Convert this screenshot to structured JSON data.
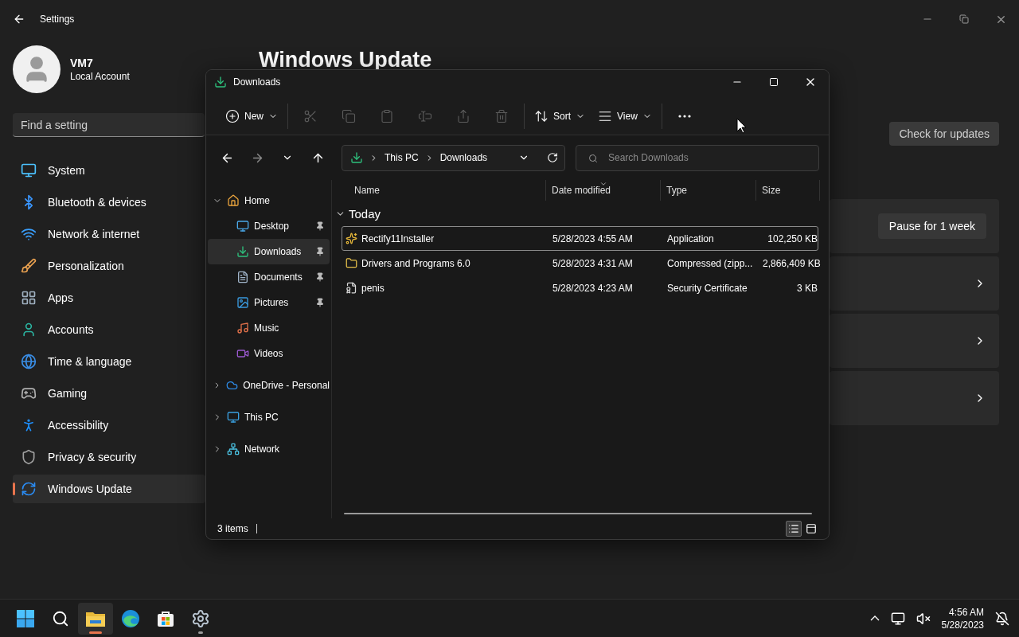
{
  "settings": {
    "title": "Settings",
    "account": {
      "name": "VM7",
      "type": "Local Account"
    },
    "search": {
      "placeholder": "Find a setting"
    },
    "nav": [
      {
        "kind": "system",
        "label": "System",
        "selected": false
      },
      {
        "kind": "bluetooth",
        "label": "Bluetooth & devices",
        "selected": false
      },
      {
        "kind": "network",
        "label": "Network & internet",
        "selected": false
      },
      {
        "kind": "personalization",
        "label": "Personalization",
        "selected": false
      },
      {
        "kind": "apps",
        "label": "Apps",
        "selected": false
      },
      {
        "kind": "accounts",
        "label": "Accounts",
        "selected": false
      },
      {
        "kind": "time",
        "label": "Time & language",
        "selected": false
      },
      {
        "kind": "gaming",
        "label": "Gaming",
        "selected": false
      },
      {
        "kind": "accessibility",
        "label": "Accessibility",
        "selected": false
      },
      {
        "kind": "privacy",
        "label": "Privacy & security",
        "selected": false
      },
      {
        "kind": "update",
        "label": "Windows Update",
        "selected": true
      }
    ],
    "page_title": "Windows Update",
    "check_button": "Check for updates",
    "cards": [
      {
        "kind": "action",
        "button": "Pause for 1 week"
      },
      {
        "kind": "link"
      },
      {
        "kind": "link"
      },
      {
        "kind": "link"
      }
    ]
  },
  "explorer": {
    "title": "Downloads",
    "toolbar_groups": [
      [
        {
          "kind": "new",
          "label": "New",
          "disabled": false
        }
      ],
      [
        {
          "kind": "cut",
          "disabled": true
        },
        {
          "kind": "copy",
          "disabled": true
        },
        {
          "kind": "paste",
          "disabled": true
        },
        {
          "kind": "rename",
          "disabled": true
        },
        {
          "kind": "share",
          "disabled": true
        },
        {
          "kind": "delete",
          "disabled": true
        }
      ],
      [
        {
          "kind": "sort",
          "label": "Sort",
          "disabled": false
        },
        {
          "kind": "view",
          "label": "View",
          "disabled": false
        }
      ],
      [
        {
          "kind": "more",
          "disabled": false
        }
      ]
    ],
    "nav_buttons": [
      {
        "kind": "back",
        "disabled": false
      },
      {
        "kind": "forward",
        "disabled": true
      },
      {
        "kind": "recent",
        "disabled": false
      },
      {
        "kind": "up",
        "disabled": false
      }
    ],
    "address": [
      "This PC",
      "Downloads"
    ],
    "search": {
      "placeholder": "Search Downloads"
    },
    "tree": [
      {
        "kind": "home",
        "label": "Home",
        "expanded": true,
        "selected": false,
        "children": [
          {
            "kind": "desktop",
            "label": "Desktop",
            "pinned": true,
            "selected": false
          },
          {
            "kind": "downloads",
            "label": "Downloads",
            "pinned": true,
            "selected": true
          },
          {
            "kind": "documents",
            "label": "Documents",
            "pinned": true,
            "selected": false
          },
          {
            "kind": "pictures",
            "label": "Pictures",
            "pinned": true,
            "selected": false
          },
          {
            "kind": "music",
            "label": "Music",
            "pinned": false,
            "selected": false
          },
          {
            "kind": "videos",
            "label": "Videos",
            "pinned": false,
            "selected": false
          }
        ]
      },
      {
        "kind": "onedrive",
        "label": "OneDrive - Personal",
        "expanded": false,
        "selected": false
      },
      {
        "kind": "thispc",
        "label": "This PC",
        "expanded": false,
        "selected": false
      },
      {
        "kind": "network",
        "label": "Network",
        "expanded": false,
        "selected": false
      }
    ],
    "columns": [
      {
        "label": "Name",
        "sorted": false
      },
      {
        "label": "Date modified",
        "sorted": true
      },
      {
        "label": "Type",
        "sorted": false
      },
      {
        "label": "Size",
        "sorted": false
      }
    ],
    "group": {
      "label": "Today",
      "expanded": true
    },
    "files": [
      {
        "kind": "app",
        "name": "Rectify11Installer",
        "date": "5/28/2023 4:55 AM",
        "type": "Application",
        "size": "102,250 KB",
        "selected": true
      },
      {
        "kind": "zip",
        "name": "Drivers and Programs 6.0",
        "date": "5/28/2023 4:31 AM",
        "type": "Compressed (zipp...",
        "size": "2,866,409 KB",
        "selected": false
      },
      {
        "kind": "cert",
        "name": "penis",
        "date": "5/28/2023 4:23 AM",
        "type": "Security Certificate",
        "size": "3 KB",
        "selected": false
      }
    ],
    "status": "3 items",
    "views": [
      {
        "kind": "details",
        "selected": true
      },
      {
        "kind": "tiles",
        "selected": false
      }
    ]
  },
  "taskbar": {
    "apps": [
      {
        "kind": "start",
        "running": false,
        "active": false
      },
      {
        "kind": "search",
        "running": false,
        "active": false
      },
      {
        "kind": "explorer",
        "running": true,
        "active": true
      },
      {
        "kind": "edge",
        "running": false,
        "active": false
      },
      {
        "kind": "store",
        "running": false,
        "active": false
      },
      {
        "kind": "settings",
        "running": true,
        "active": false
      }
    ],
    "time": "4:56 AM",
    "date": "5/28/2023"
  }
}
